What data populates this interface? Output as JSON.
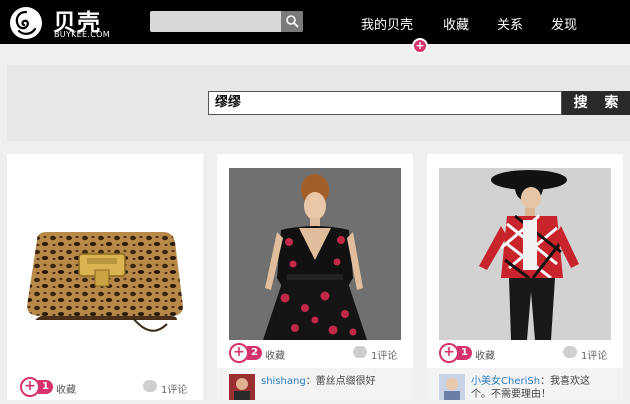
{
  "header": {
    "logo_cn": "贝壳",
    "logo_en": "BUYKEE.COM",
    "search_placeholder": "",
    "nav": [
      {
        "label": "我的贝壳"
      },
      {
        "label": "收藏"
      },
      {
        "label": "关系"
      },
      {
        "label": "发现"
      }
    ],
    "nav_badge": "+"
  },
  "search": {
    "query": "缪缪",
    "button_label": "搜 索"
  },
  "cards": [
    {
      "image": "leopard-print-handbag",
      "likes": "1",
      "fav_label": "收藏",
      "comments": "1评论"
    },
    {
      "image": "model-black-floral-dress",
      "likes": "2",
      "fav_label": "收藏",
      "comments": "1评论",
      "comment_user": "shishang",
      "comment_text": "：蕾丝点缀很好"
    },
    {
      "image": "model-red-plaid-outfit",
      "likes": "1",
      "fav_label": "收藏",
      "comments": "1评论",
      "comment_user": "小美女CheriSh",
      "comment_text": "：我喜欢这个。不需要理由！"
    }
  ],
  "colors": {
    "accent": "#d6336c",
    "topbar": "#000000",
    "link": "#2a7dc0"
  }
}
